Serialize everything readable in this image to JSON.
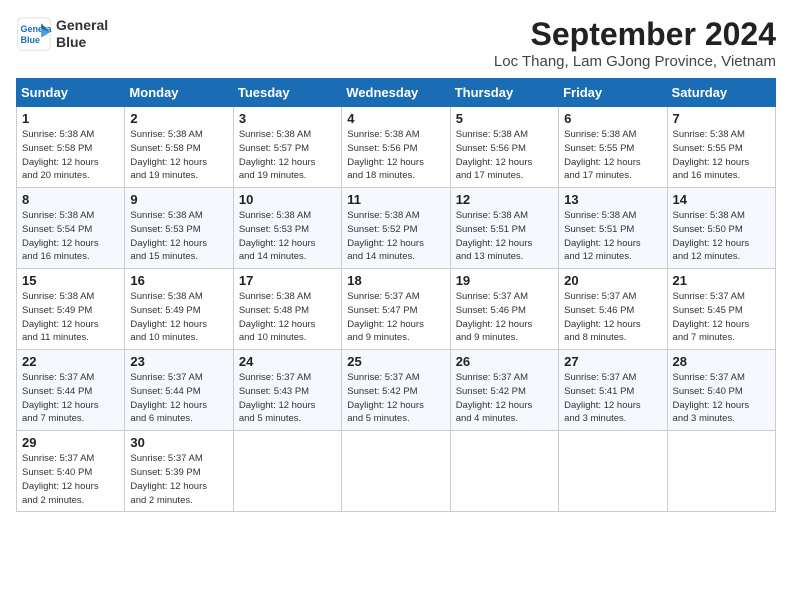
{
  "header": {
    "logo_line1": "General",
    "logo_line2": "Blue",
    "month": "September 2024",
    "location": "Loc Thang, Lam GJong Province, Vietnam"
  },
  "weekdays": [
    "Sunday",
    "Monday",
    "Tuesday",
    "Wednesday",
    "Thursday",
    "Friday",
    "Saturday"
  ],
  "weeks": [
    [
      {
        "day": "1",
        "info": "Sunrise: 5:38 AM\nSunset: 5:58 PM\nDaylight: 12 hours\nand 20 minutes."
      },
      {
        "day": "2",
        "info": "Sunrise: 5:38 AM\nSunset: 5:58 PM\nDaylight: 12 hours\nand 19 minutes."
      },
      {
        "day": "3",
        "info": "Sunrise: 5:38 AM\nSunset: 5:57 PM\nDaylight: 12 hours\nand 19 minutes."
      },
      {
        "day": "4",
        "info": "Sunrise: 5:38 AM\nSunset: 5:56 PM\nDaylight: 12 hours\nand 18 minutes."
      },
      {
        "day": "5",
        "info": "Sunrise: 5:38 AM\nSunset: 5:56 PM\nDaylight: 12 hours\nand 17 minutes."
      },
      {
        "day": "6",
        "info": "Sunrise: 5:38 AM\nSunset: 5:55 PM\nDaylight: 12 hours\nand 17 minutes."
      },
      {
        "day": "7",
        "info": "Sunrise: 5:38 AM\nSunset: 5:55 PM\nDaylight: 12 hours\nand 16 minutes."
      }
    ],
    [
      {
        "day": "8",
        "info": "Sunrise: 5:38 AM\nSunset: 5:54 PM\nDaylight: 12 hours\nand 16 minutes."
      },
      {
        "day": "9",
        "info": "Sunrise: 5:38 AM\nSunset: 5:53 PM\nDaylight: 12 hours\nand 15 minutes."
      },
      {
        "day": "10",
        "info": "Sunrise: 5:38 AM\nSunset: 5:53 PM\nDaylight: 12 hours\nand 14 minutes."
      },
      {
        "day": "11",
        "info": "Sunrise: 5:38 AM\nSunset: 5:52 PM\nDaylight: 12 hours\nand 14 minutes."
      },
      {
        "day": "12",
        "info": "Sunrise: 5:38 AM\nSunset: 5:51 PM\nDaylight: 12 hours\nand 13 minutes."
      },
      {
        "day": "13",
        "info": "Sunrise: 5:38 AM\nSunset: 5:51 PM\nDaylight: 12 hours\nand 12 minutes."
      },
      {
        "day": "14",
        "info": "Sunrise: 5:38 AM\nSunset: 5:50 PM\nDaylight: 12 hours\nand 12 minutes."
      }
    ],
    [
      {
        "day": "15",
        "info": "Sunrise: 5:38 AM\nSunset: 5:49 PM\nDaylight: 12 hours\nand 11 minutes."
      },
      {
        "day": "16",
        "info": "Sunrise: 5:38 AM\nSunset: 5:49 PM\nDaylight: 12 hours\nand 10 minutes."
      },
      {
        "day": "17",
        "info": "Sunrise: 5:38 AM\nSunset: 5:48 PM\nDaylight: 12 hours\nand 10 minutes."
      },
      {
        "day": "18",
        "info": "Sunrise: 5:37 AM\nSunset: 5:47 PM\nDaylight: 12 hours\nand 9 minutes."
      },
      {
        "day": "19",
        "info": "Sunrise: 5:37 AM\nSunset: 5:46 PM\nDaylight: 12 hours\nand 9 minutes."
      },
      {
        "day": "20",
        "info": "Sunrise: 5:37 AM\nSunset: 5:46 PM\nDaylight: 12 hours\nand 8 minutes."
      },
      {
        "day": "21",
        "info": "Sunrise: 5:37 AM\nSunset: 5:45 PM\nDaylight: 12 hours\nand 7 minutes."
      }
    ],
    [
      {
        "day": "22",
        "info": "Sunrise: 5:37 AM\nSunset: 5:44 PM\nDaylight: 12 hours\nand 7 minutes."
      },
      {
        "day": "23",
        "info": "Sunrise: 5:37 AM\nSunset: 5:44 PM\nDaylight: 12 hours\nand 6 minutes."
      },
      {
        "day": "24",
        "info": "Sunrise: 5:37 AM\nSunset: 5:43 PM\nDaylight: 12 hours\nand 5 minutes."
      },
      {
        "day": "25",
        "info": "Sunrise: 5:37 AM\nSunset: 5:42 PM\nDaylight: 12 hours\nand 5 minutes."
      },
      {
        "day": "26",
        "info": "Sunrise: 5:37 AM\nSunset: 5:42 PM\nDaylight: 12 hours\nand 4 minutes."
      },
      {
        "day": "27",
        "info": "Sunrise: 5:37 AM\nSunset: 5:41 PM\nDaylight: 12 hours\nand 3 minutes."
      },
      {
        "day": "28",
        "info": "Sunrise: 5:37 AM\nSunset: 5:40 PM\nDaylight: 12 hours\nand 3 minutes."
      }
    ],
    [
      {
        "day": "29",
        "info": "Sunrise: 5:37 AM\nSunset: 5:40 PM\nDaylight: 12 hours\nand 2 minutes."
      },
      {
        "day": "30",
        "info": "Sunrise: 5:37 AM\nSunset: 5:39 PM\nDaylight: 12 hours\nand 2 minutes."
      },
      null,
      null,
      null,
      null,
      null
    ]
  ]
}
